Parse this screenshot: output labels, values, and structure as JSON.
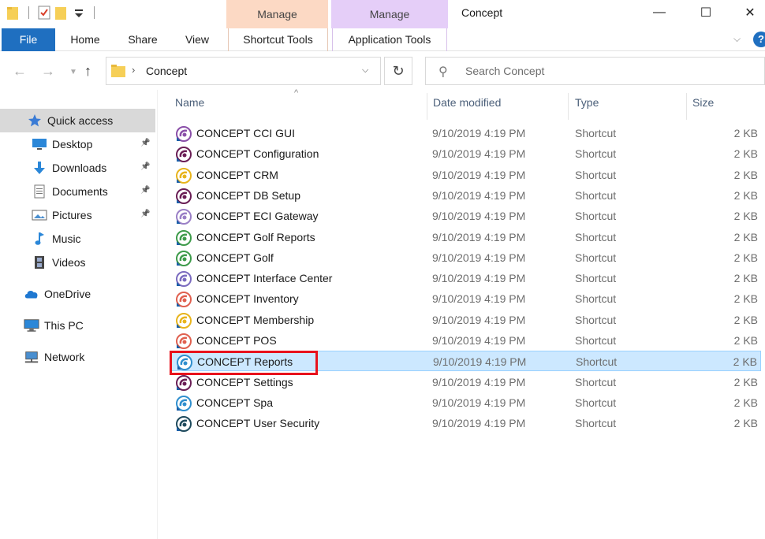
{
  "window": {
    "title": "Concept",
    "context_tab_1": "Manage",
    "context_tab_2": "Manage",
    "min_glyph": "—",
    "max_glyph": "☐",
    "close_glyph": "✕"
  },
  "ribbon": {
    "tabs": [
      "File",
      "Home",
      "Share",
      "View",
      "Shortcut Tools",
      "Application Tools"
    ],
    "file_color": "#1f6fc0"
  },
  "address": {
    "crumb": "Concept",
    "search_placeholder": "Search Concept"
  },
  "sidebar": {
    "items": [
      {
        "label": "Quick access",
        "icon": "star-icon",
        "pinned": false,
        "selected": true
      },
      {
        "label": "Desktop",
        "icon": "desktop-icon",
        "pinned": true
      },
      {
        "label": "Downloads",
        "icon": "download-arrow-icon",
        "pinned": true
      },
      {
        "label": "Documents",
        "icon": "document-icon",
        "pinned": true
      },
      {
        "label": "Pictures",
        "icon": "picture-icon",
        "pinned": true
      },
      {
        "label": "Music",
        "icon": "music-note-icon",
        "pinned": false
      },
      {
        "label": "Videos",
        "icon": "film-icon",
        "pinned": false
      },
      {
        "label": "OneDrive",
        "icon": "cloud-icon",
        "pinned": false
      },
      {
        "label": "This PC",
        "icon": "computer-icon",
        "pinned": false
      },
      {
        "label": "Network",
        "icon": "network-icon",
        "pinned": false
      }
    ]
  },
  "columns": {
    "name": "Name",
    "date": "Date modified",
    "type": "Type",
    "size": "Size"
  },
  "files": [
    {
      "name": "CONCEPT CCI GUI",
      "date": "9/10/2019 4:19 PM",
      "type": "Shortcut",
      "size": "2 KB",
      "color": "#8a4fa8"
    },
    {
      "name": "CONCEPT Configuration",
      "date": "9/10/2019 4:19 PM",
      "type": "Shortcut",
      "size": "2 KB",
      "color": "#6a1e55"
    },
    {
      "name": "CONCEPT CRM",
      "date": "9/10/2019 4:19 PM",
      "type": "Shortcut",
      "size": "2 KB",
      "color": "#e8b41c"
    },
    {
      "name": "CONCEPT DB Setup",
      "date": "9/10/2019 4:19 PM",
      "type": "Shortcut",
      "size": "2 KB",
      "color": "#6a1e55"
    },
    {
      "name": "CONCEPT ECI Gateway",
      "date": "9/10/2019 4:19 PM",
      "type": "Shortcut",
      "size": "2 KB",
      "color": "#9a7fc6"
    },
    {
      "name": "CONCEPT Golf Reports",
      "date": "9/10/2019 4:19 PM",
      "type": "Shortcut",
      "size": "2 KB",
      "color": "#3e9b4a"
    },
    {
      "name": "CONCEPT Golf",
      "date": "9/10/2019 4:19 PM",
      "type": "Shortcut",
      "size": "2 KB",
      "color": "#3e9b4a"
    },
    {
      "name": "CONCEPT Interface Center",
      "date": "9/10/2019 4:19 PM",
      "type": "Shortcut",
      "size": "2 KB",
      "color": "#7b6bbf"
    },
    {
      "name": "CONCEPT Inventory",
      "date": "9/10/2019 4:19 PM",
      "type": "Shortcut",
      "size": "2 KB",
      "color": "#e0604f"
    },
    {
      "name": "CONCEPT Membership",
      "date": "9/10/2019 4:19 PM",
      "type": "Shortcut",
      "size": "2 KB",
      "color": "#e8b41c"
    },
    {
      "name": "CONCEPT POS",
      "date": "9/10/2019 4:19 PM",
      "type": "Shortcut",
      "size": "2 KB",
      "color": "#e0604f"
    },
    {
      "name": "CONCEPT Reports",
      "date": "9/10/2019 4:19 PM",
      "type": "Shortcut",
      "size": "2 KB",
      "color": "#2f8fce",
      "selected": true
    },
    {
      "name": "CONCEPT Settings",
      "date": "9/10/2019 4:19 PM",
      "type": "Shortcut",
      "size": "2 KB",
      "color": "#6a1e55"
    },
    {
      "name": "CONCEPT Spa",
      "date": "9/10/2019 4:19 PM",
      "type": "Shortcut",
      "size": "2 KB",
      "color": "#2f8fce"
    },
    {
      "name": "CONCEPT User Security",
      "date": "9/10/2019 4:19 PM",
      "type": "Shortcut",
      "size": "2 KB",
      "color": "#1e4a5c"
    }
  ],
  "highlight_color": "#e8121c"
}
